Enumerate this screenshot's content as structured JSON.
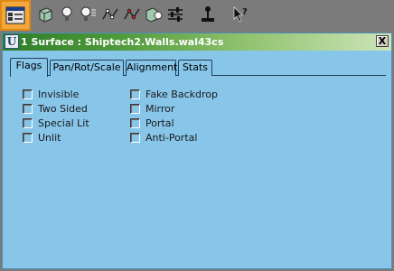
{
  "toolbar": {
    "buttons": [
      {
        "icon": "surface-properties-icon",
        "active": true
      },
      {
        "icon": "mesh-box-icon"
      },
      {
        "icon": "light-bulb-icon"
      },
      {
        "icon": "light-bulb-list-icon"
      },
      {
        "icon": "spline-path-icon"
      },
      {
        "icon": "spline-path-red-icon"
      },
      {
        "icon": "mesh-light-icon"
      },
      {
        "icon": "sliders-icon"
      },
      {
        "icon": "joystick-icon"
      },
      {
        "icon": "pointer-help-icon"
      }
    ]
  },
  "window": {
    "title": "1 Surface : Shiptech2.Walls.wal43cs",
    "close_label": "X",
    "title_icon": "U"
  },
  "tabs": [
    {
      "label": "Flags",
      "active": true
    },
    {
      "label": "Pan/Rot/Scale"
    },
    {
      "label": "Alignment"
    },
    {
      "label": "Stats"
    }
  ],
  "flags": {
    "left": [
      {
        "label": "Invisible",
        "checked": false
      },
      {
        "label": "Two Sided",
        "checked": false
      },
      {
        "label": "Special Lit",
        "checked": false
      },
      {
        "label": "Unlit",
        "checked": false
      }
    ],
    "right": [
      {
        "label": "Fake Backdrop",
        "checked": false
      },
      {
        "label": "Mirror",
        "checked": false
      },
      {
        "label": "Portal",
        "checked": false
      },
      {
        "label": "Anti-Portal",
        "checked": false
      }
    ]
  },
  "colors": {
    "panel": "#87c5e9",
    "toolbar": "#7b7b7b",
    "active_button": "#f3a73c",
    "titlebar_start": "#2f7d2a",
    "titlebar_end": "#cde5b8"
  }
}
